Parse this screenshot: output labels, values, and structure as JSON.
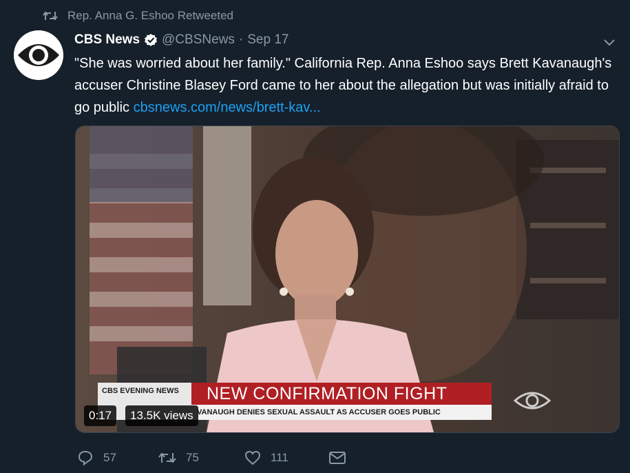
{
  "retweet": {
    "label": "Rep. Anna G. Eshoo Retweeted"
  },
  "tweet": {
    "display_name": "CBS News",
    "handle": "@CBSNews",
    "separator": "·",
    "date": "Sep 17",
    "text": "\"She was worried about her family.\" California Rep. Anna Eshoo says Brett Kavanaugh's accuser Christine Blasey Ford came to her about the allegation but was initially afraid to go public",
    "link": "cbsnews.com/news/brett-kav..."
  },
  "video": {
    "network_label": "CBS EVENING NEWS",
    "headline": "NEW CONFIRMATION FIGHT",
    "subheadline": "VANAUGH DENIES SEXUAL ASSAULT AS ACCUSER GOES PUBLIC",
    "duration": "0:17",
    "views": "13.5K views"
  },
  "actions": {
    "replies": "57",
    "retweets": "75",
    "likes": "111"
  },
  "colors": {
    "background": "#15202b",
    "secondary_text": "#8899a6",
    "link": "#1da1f2",
    "verified": "#ffffff",
    "headline_red": "#b01f24"
  },
  "icons": [
    "retweet-icon",
    "cbs-eye-logo",
    "verified-icon",
    "chevron-down-icon",
    "reply-icon",
    "like-icon",
    "share-icon"
  ]
}
